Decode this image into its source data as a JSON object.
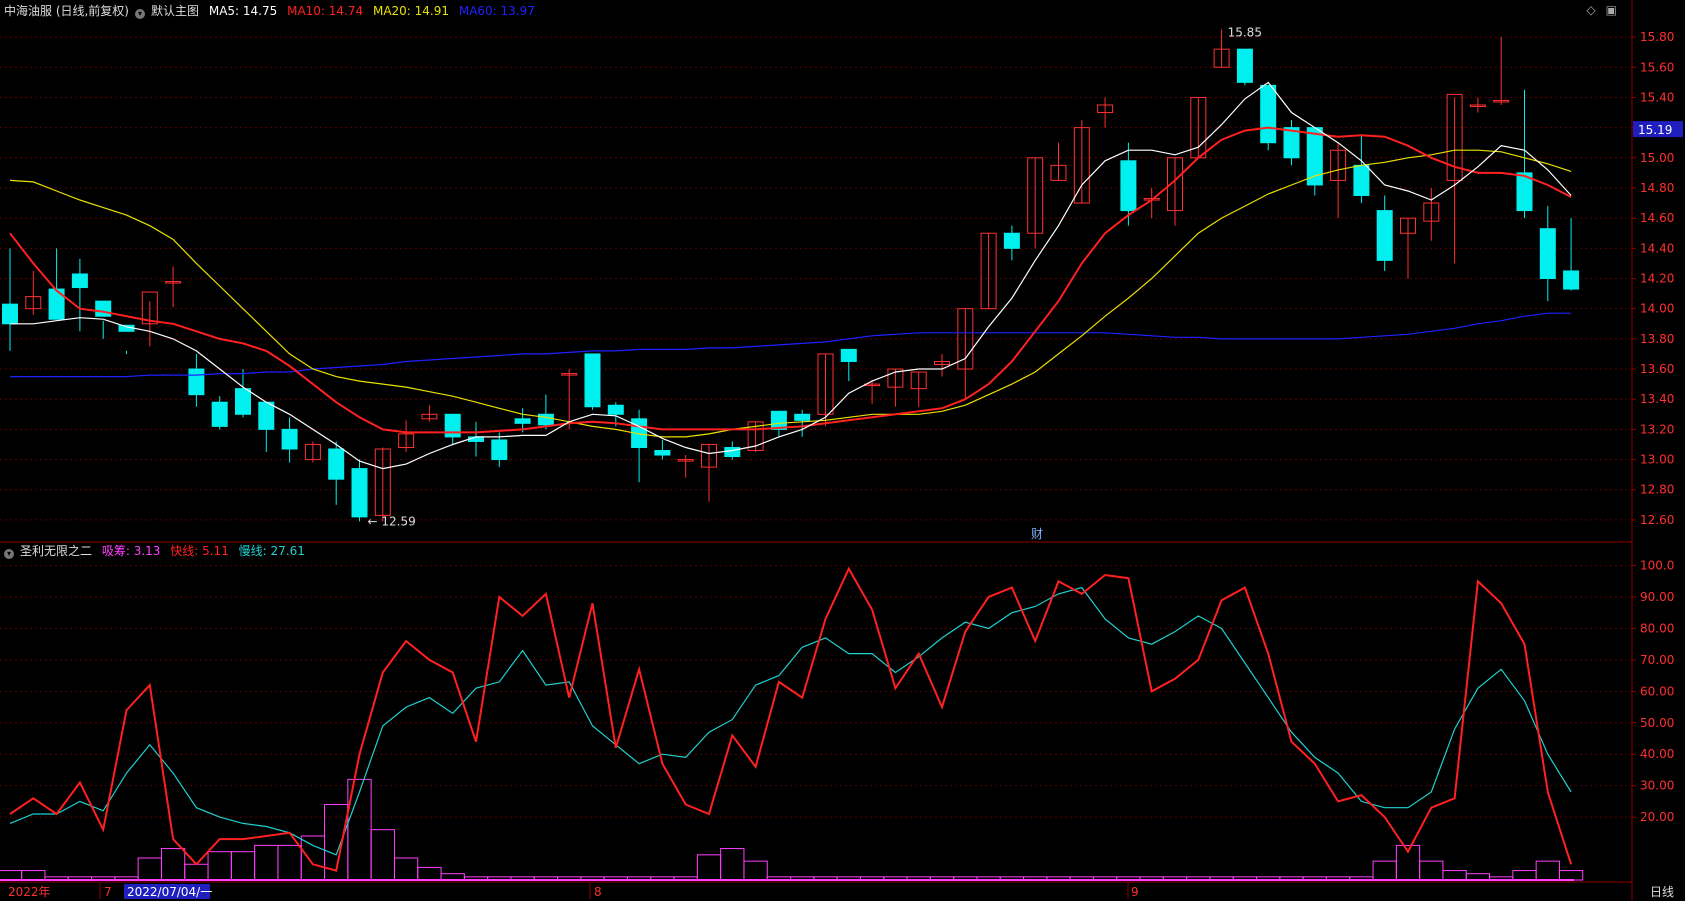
{
  "header": {
    "stock_label": "中海油服 (日线,前复权)",
    "main_chart_label": "默认主图",
    "ma5_label": "MA5: 14.75",
    "ma10_label": "MA10: 14.74",
    "ma20_label": "MA20: 14.91",
    "ma60_label": "MA60: 13.97",
    "ma5_color": "#ffffff",
    "ma10_color": "#ff2020",
    "ma20_color": "#e8e000",
    "ma60_color": "#2020ff"
  },
  "indicator": {
    "name": "圣利无限之二",
    "absorb_label": "吸筹: 3.13",
    "fast_label": "快线: 5.11",
    "slow_label": "慢线: 27.61",
    "absorb_color": "#ff40ff",
    "fast_color": "#ff2020",
    "slow_color": "#20d0d0"
  },
  "current_price_tag": "15.19",
  "max_marker": "15.85",
  "min_marker": "12.59",
  "finance_marker": "财",
  "period_button": "日线",
  "timeline": {
    "year_label": "2022年",
    "m7": "7",
    "cursor_date": "2022/07/04/一",
    "m8": "8",
    "m9": "9"
  },
  "chart_data": [
    {
      "type": "candlestick",
      "ylim": [
        12.5,
        15.9
      ],
      "y_ticks": [
        "15.80",
        "15.60",
        "15.40",
        "15.20",
        "15.00",
        "14.80",
        "14.60",
        "14.40",
        "14.20",
        "14.00",
        "13.80",
        "13.60",
        "13.40",
        "13.20",
        "13.00",
        "12.80",
        "12.60"
      ],
      "candles": [
        [
          14.03,
          14.4,
          13.9,
          13.72
        ],
        [
          14.0,
          14.25,
          14.08,
          13.96
        ],
        [
          14.13,
          14.4,
          13.93,
          14.12
        ],
        [
          14.23,
          14.33,
          14.14,
          13.85
        ],
        [
          14.05,
          13.92,
          13.95,
          13.8
        ],
        [
          13.89,
          13.72,
          13.85,
          13.7
        ],
        [
          13.9,
          14.05,
          14.11,
          13.75
        ],
        [
          14.18,
          14.28,
          14.18,
          14.01
        ],
        [
          13.6,
          13.7,
          13.43,
          13.35
        ],
        [
          13.38,
          13.42,
          13.22,
          13.2
        ],
        [
          13.47,
          13.6,
          13.3,
          13.28
        ],
        [
          13.38,
          13.38,
          13.2,
          13.05
        ],
        [
          13.2,
          13.28,
          13.07,
          12.98
        ],
        [
          13.0,
          13.12,
          13.1,
          12.98
        ],
        [
          13.07,
          13.12,
          12.87,
          12.7
        ],
        [
          12.94,
          13.0,
          12.62,
          12.59
        ],
        [
          12.63,
          13.08,
          13.07,
          12.59
        ],
        [
          13.08,
          13.26,
          13.17,
          13.05
        ],
        [
          13.27,
          13.36,
          13.3,
          13.25
        ],
        [
          13.3,
          13.3,
          13.15,
          13.1
        ],
        [
          13.15,
          13.25,
          13.12,
          13.02
        ],
        [
          13.13,
          13.18,
          13.0,
          12.95
        ],
        [
          13.27,
          13.34,
          13.24,
          13.18
        ],
        [
          13.3,
          13.43,
          13.23,
          13.2
        ],
        [
          13.57,
          13.6,
          13.57,
          13.2
        ],
        [
          13.7,
          13.7,
          13.35,
          13.33
        ],
        [
          13.36,
          13.38,
          13.3,
          13.22
        ],
        [
          13.27,
          13.33,
          13.08,
          12.85
        ],
        [
          13.06,
          13.13,
          13.03,
          13.0
        ],
        [
          13.0,
          13.03,
          13.0,
          12.88
        ],
        [
          12.95,
          13.1,
          13.1,
          12.72
        ],
        [
          13.08,
          13.12,
          13.02,
          13.0
        ],
        [
          13.06,
          13.25,
          13.25,
          13.05
        ],
        [
          13.32,
          13.32,
          13.2,
          13.15
        ],
        [
          13.3,
          13.33,
          13.26,
          13.15
        ],
        [
          13.3,
          13.7,
          13.7,
          13.22
        ],
        [
          13.73,
          13.7,
          13.65,
          13.52
        ],
        [
          13.5,
          13.53,
          13.5,
          13.37
        ],
        [
          13.48,
          13.6,
          13.6,
          13.35
        ],
        [
          13.47,
          13.58,
          13.58,
          13.35
        ],
        [
          13.63,
          13.7,
          13.65,
          13.55
        ],
        [
          13.6,
          14.0,
          14.0,
          13.4
        ],
        [
          14.0,
          14.5,
          14.5,
          14.0
        ],
        [
          14.5,
          14.55,
          14.4,
          14.32
        ],
        [
          14.5,
          15.0,
          15.0,
          14.4
        ],
        [
          14.85,
          15.1,
          14.95,
          14.85
        ],
        [
          14.7,
          15.25,
          15.2,
          14.7
        ],
        [
          15.3,
          15.4,
          15.35,
          15.2
        ],
        [
          14.98,
          15.1,
          14.65,
          14.55
        ],
        [
          14.73,
          14.8,
          14.73,
          14.6
        ],
        [
          14.65,
          15.0,
          15.0,
          14.55
        ],
        [
          15.0,
          15.4,
          15.4,
          15.0
        ],
        [
          15.6,
          15.85,
          15.72,
          15.6
        ],
        [
          15.72,
          15.72,
          15.5,
          15.48
        ],
        [
          15.48,
          15.48,
          15.1,
          15.05
        ],
        [
          15.2,
          15.25,
          15.0,
          14.95
        ],
        [
          15.2,
          15.2,
          14.82,
          14.75
        ],
        [
          14.85,
          15.1,
          15.05,
          14.6
        ],
        [
          14.95,
          15.15,
          14.75,
          14.7
        ],
        [
          14.65,
          14.75,
          14.32,
          14.25
        ],
        [
          14.5,
          14.6,
          14.6,
          14.2
        ],
        [
          14.58,
          14.8,
          14.7,
          14.45
        ],
        [
          14.85,
          15.4,
          15.42,
          14.3
        ],
        [
          15.35,
          15.4,
          15.35,
          15.3
        ],
        [
          15.38,
          15.8,
          15.38,
          15.35
        ],
        [
          14.9,
          15.45,
          14.65,
          14.6
        ],
        [
          14.53,
          14.68,
          14.2,
          14.05
        ],
        [
          14.25,
          14.6,
          14.13,
          14.12
        ]
      ],
      "ma5": [
        13.9,
        13.9,
        13.92,
        13.94,
        13.93,
        13.88,
        13.85,
        13.8,
        13.72,
        13.6,
        13.48,
        13.38,
        13.3,
        13.2,
        13.1,
        12.99,
        12.94,
        12.97,
        13.04,
        13.1,
        13.15,
        13.15,
        13.16,
        13.16,
        13.25,
        13.3,
        13.29,
        13.22,
        13.14,
        13.08,
        13.04,
        13.06,
        13.09,
        13.15,
        13.2,
        13.28,
        13.44,
        13.52,
        13.58,
        13.6,
        13.6,
        13.67,
        13.88,
        14.07,
        14.32,
        14.55,
        14.82,
        14.98,
        15.05,
        15.05,
        15.02,
        15.07,
        15.22,
        15.39,
        15.5,
        15.3,
        15.2,
        15.1,
        14.98,
        14.82,
        14.78,
        14.72,
        14.82,
        14.94,
        15.08,
        15.05,
        14.92,
        14.75
      ],
      "ma10": [
        14.5,
        14.3,
        14.12,
        14.0,
        13.98,
        13.95,
        13.92,
        13.9,
        13.85,
        13.8,
        13.77,
        13.72,
        13.62,
        13.5,
        13.38,
        13.28,
        13.2,
        13.18,
        13.18,
        13.18,
        13.18,
        13.19,
        13.2,
        13.22,
        13.24,
        13.25,
        13.24,
        13.22,
        13.2,
        13.2,
        13.2,
        13.2,
        13.2,
        13.21,
        13.22,
        13.24,
        13.26,
        13.28,
        13.3,
        13.32,
        13.34,
        13.4,
        13.5,
        13.65,
        13.85,
        14.05,
        14.3,
        14.5,
        14.62,
        14.72,
        14.85,
        15.0,
        15.12,
        15.18,
        15.2,
        15.18,
        15.16,
        15.14,
        15.15,
        15.14,
        15.08,
        15.0,
        14.94,
        14.9,
        14.9,
        14.88,
        14.82,
        14.74
      ],
      "ma20": [
        14.85,
        14.84,
        14.78,
        14.72,
        14.67,
        14.62,
        14.55,
        14.46,
        14.3,
        14.15,
        14.0,
        13.85,
        13.7,
        13.6,
        13.55,
        13.52,
        13.5,
        13.48,
        13.45,
        13.42,
        13.38,
        13.34,
        13.3,
        13.28,
        13.25,
        13.22,
        13.2,
        13.17,
        13.15,
        13.15,
        13.17,
        13.2,
        13.22,
        13.24,
        13.25,
        13.26,
        13.28,
        13.3,
        13.3,
        13.3,
        13.32,
        13.36,
        13.43,
        13.5,
        13.58,
        13.7,
        13.82,
        13.95,
        14.07,
        14.2,
        14.35,
        14.5,
        14.6,
        14.68,
        14.76,
        14.82,
        14.88,
        14.92,
        14.95,
        14.97,
        15.0,
        15.02,
        15.05,
        15.05,
        15.04,
        15.0,
        14.96,
        14.91
      ],
      "ma60": [
        13.55,
        13.55,
        13.55,
        13.55,
        13.55,
        13.55,
        13.56,
        13.56,
        13.56,
        13.57,
        13.57,
        13.58,
        13.58,
        13.6,
        13.61,
        13.62,
        13.63,
        13.65,
        13.66,
        13.67,
        13.68,
        13.69,
        13.7,
        13.7,
        13.71,
        13.72,
        13.72,
        13.73,
        13.73,
        13.73,
        13.74,
        13.74,
        13.75,
        13.76,
        13.77,
        13.78,
        13.8,
        13.82,
        13.83,
        13.84,
        13.84,
        13.84,
        13.84,
        13.84,
        13.84,
        13.84,
        13.84,
        13.84,
        13.83,
        13.82,
        13.81,
        13.81,
        13.8,
        13.8,
        13.8,
        13.8,
        13.8,
        13.8,
        13.81,
        13.82,
        13.83,
        13.85,
        13.87,
        13.9,
        13.92,
        13.95,
        13.97,
        13.97
      ]
    },
    {
      "type": "line",
      "ylim": [
        0,
        104
      ],
      "y_ticks": [
        "100.0",
        "90.00",
        "80.00",
        "70.00",
        "60.00",
        "50.00",
        "40.00",
        "30.00",
        "20.00"
      ],
      "fast": [
        21,
        26,
        21,
        31,
        16,
        54,
        62,
        13,
        5,
        13,
        13,
        14,
        15,
        5,
        3,
        40,
        66,
        76,
        70,
        66,
        44,
        90,
        84,
        91,
        58,
        88,
        42,
        67,
        37,
        24,
        21,
        46,
        36,
        63,
        58,
        83,
        99,
        86,
        61,
        72,
        55,
        79,
        90,
        93,
        76,
        95,
        91,
        97,
        96,
        60,
        64,
        70,
        89,
        93,
        72,
        44,
        37,
        25,
        27,
        20,
        9,
        23,
        26,
        95,
        88,
        75,
        28,
        5
      ],
      "slow": [
        18,
        21,
        21,
        25,
        22,
        34,
        43,
        34,
        23,
        20,
        18,
        17,
        15,
        11,
        8,
        28,
        49,
        55,
        58,
        53,
        61,
        63,
        73,
        62,
        63,
        49,
        43,
        37,
        40,
        39,
        47,
        51,
        62,
        65,
        74,
        77,
        72,
        72,
        66,
        71,
        77,
        82,
        80,
        85,
        87,
        91,
        93,
        83,
        77,
        75,
        79,
        84,
        80,
        69,
        58,
        47,
        39,
        34,
        25,
        23,
        23,
        28,
        48,
        61,
        67,
        57,
        40,
        28
      ],
      "absorb": [
        3,
        3,
        1,
        1,
        1,
        1,
        7,
        10,
        5,
        9,
        9,
        11,
        11,
        14,
        24,
        32,
        16,
        7,
        4,
        2,
        1,
        1,
        1,
        1,
        1,
        1,
        1,
        1,
        1,
        1,
        8,
        10,
        6,
        1,
        1,
        1,
        1,
        1,
        1,
        1,
        1,
        1,
        1,
        1,
        1,
        1,
        1,
        1,
        1,
        1,
        1,
        1,
        1,
        1,
        1,
        1,
        1,
        1,
        1,
        6,
        11,
        6,
        3,
        2,
        1,
        3,
        6,
        3
      ]
    }
  ]
}
